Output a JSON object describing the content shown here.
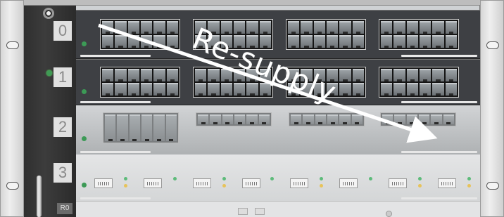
{
  "slots": [
    {
      "label": "0"
    },
    {
      "label": "1"
    },
    {
      "label": "2"
    },
    {
      "label": "3"
    }
  ],
  "rail_label": "R0",
  "annotation": {
    "text": "Re-supply",
    "color": "#ffffff"
  },
  "colors": {
    "led_green": "#3c9a56",
    "card_dark": "#3e4044",
    "led_amber": "#e7c35a"
  },
  "icons": [
    "screw-icon",
    "led-icon",
    "arrow-icon"
  ]
}
